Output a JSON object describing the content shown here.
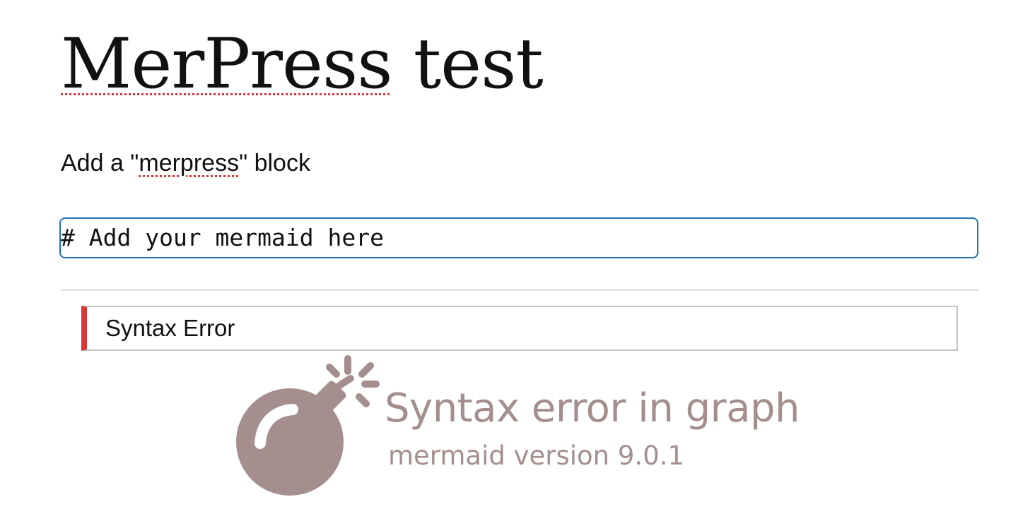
{
  "post": {
    "title_word1": "MerPress",
    "title_rest": " test"
  },
  "paragraph": {
    "prefix": "Add a \"",
    "keyword": "merpress",
    "suffix": "\" block"
  },
  "code_block": {
    "value": "# Add your mermaid here"
  },
  "notice": {
    "text": "Syntax Error",
    "accent_color": "#d63638"
  },
  "mermaid_error": {
    "icon": "bomb-icon",
    "title": "Syntax error in graph",
    "version": "mermaid version 9.0.1",
    "color": "#a58e8e"
  },
  "colors": {
    "input_border": "#2271b1",
    "misspelling_underline": "#d63638"
  }
}
